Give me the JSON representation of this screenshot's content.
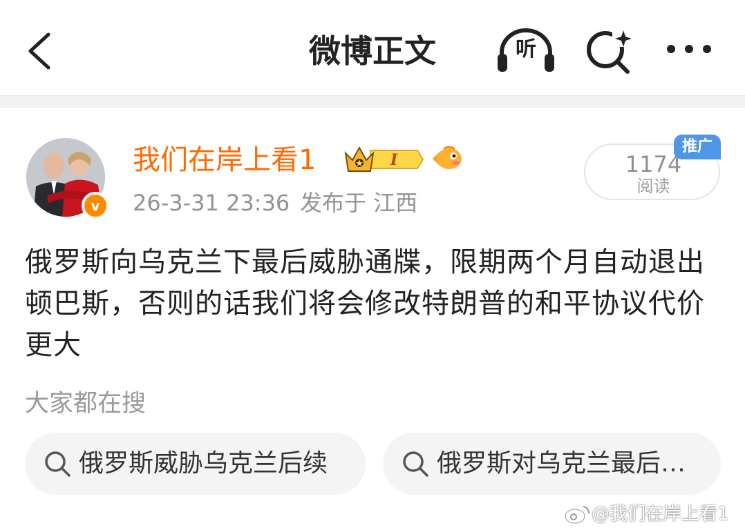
{
  "header": {
    "title": "微博正文",
    "listen_label": "听",
    "icons": [
      "back-icon",
      "headphones-icon",
      "search-sparkle-icon",
      "more-icon"
    ]
  },
  "post": {
    "author": {
      "name": "我们在岸上看1",
      "verified_mark": "v",
      "level_badge": "I"
    },
    "time": "26-3-31 23:36",
    "location": "发布于 江西",
    "read_count": "1174",
    "read_label": "阅读",
    "promo_tag": "推广",
    "text": "俄罗斯向乌克兰下最后威胁通牒，限期两个月自动退出顿巴斯，否则的话我们将会修改特朗普的和平协议代价更大"
  },
  "search": {
    "heading": "大家都在搜",
    "chips": [
      {
        "text": "俄罗斯威胁乌克兰后续"
      },
      {
        "text": "俄罗斯对乌克兰最后…"
      }
    ]
  },
  "watermark": "@我们在岸上看1",
  "colors": {
    "username": "#ff6a00",
    "promo": "#4f96e6",
    "verified": "#ff8a00",
    "meta": "#939393"
  }
}
